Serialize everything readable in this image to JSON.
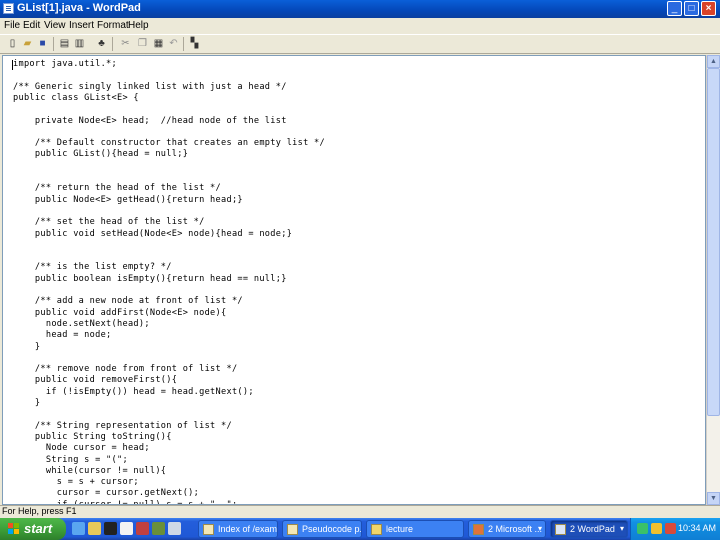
{
  "window": {
    "title": "GList[1].java - WordPad"
  },
  "menu": [
    "File",
    "Edit",
    "View",
    "Insert",
    "Format",
    "Help"
  ],
  "toolbar": {
    "icons": [
      "new-document-icon",
      "open-folder-icon",
      "save-icon",
      "print-icon",
      "print-preview-icon",
      "find-icon",
      "cut-icon",
      "copy-icon",
      "paste-icon",
      "undo-icon",
      "insert-datetime-icon"
    ]
  },
  "editor": {
    "lines": [
      "import java.util.*;",
      "",
      "/** Generic singly linked list with just a head */",
      "public class GList<E> {",
      "",
      "    private Node<E> head;  //head node of the list",
      "",
      "    /** Default constructor that creates an empty list */",
      "    public GList(){head = null;}",
      "",
      "",
      "    /** return the head of the list */",
      "    public Node<E> getHead(){return head;}",
      "",
      "    /** set the head of the list */",
      "    public void setHead(Node<E> node){head = node;}",
      "",
      "",
      "    /** is the list empty? */",
      "    public boolean isEmpty(){return head == null;}",
      "",
      "    /** add a new node at front of list */",
      "    public void addFirst(Node<E> node){",
      "      node.setNext(head);",
      "      head = node;",
      "    }",
      "",
      "    /** remove node from front of list */",
      "    public void removeFirst(){",
      "      if (!isEmpty()) head = head.getNext();",
      "    }",
      "",
      "    /** String representation of list */",
      "    public String toString(){",
      "      Node cursor = head;",
      "      String s = \"(\";",
      "      while(cursor != null){",
      "        s = s + cursor;",
      "        cursor = cursor.getNext();",
      "        if (cursor != null) s = s + \", \";"
    ]
  },
  "statusbar": {
    "text": "For Help, press F1"
  },
  "taskbar": {
    "start_label": "start",
    "tasks": [
      {
        "label": "Index of /exam...",
        "icon": "ie-icon"
      },
      {
        "label": "Pseudocode p...",
        "icon": "document-icon"
      },
      {
        "label": "lecture",
        "icon": "folder-icon"
      },
      {
        "label": "2 Microsoft ...",
        "icon": "powerpoint-icon"
      },
      {
        "label": "2 WordPad",
        "icon": "wordpad-icon",
        "active": true
      }
    ],
    "clock": "10:34 AM"
  },
  "scroll": {
    "position": 0.0,
    "visible_fraction": 0.82
  }
}
